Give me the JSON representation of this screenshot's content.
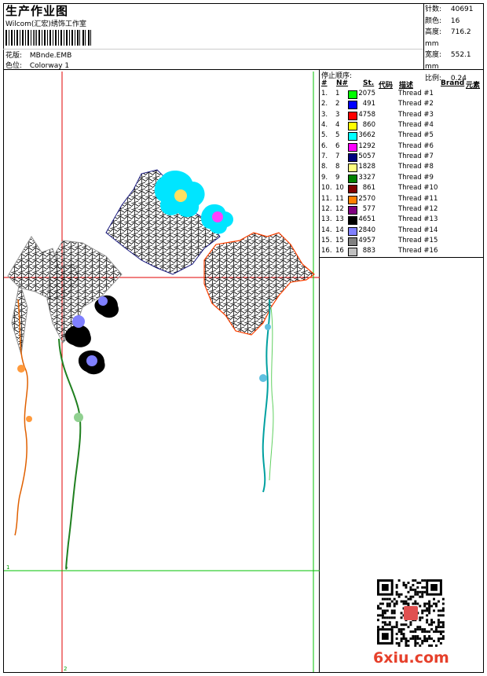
{
  "header": {
    "title": "生产作业图",
    "company": "Wilcom(汇宏)绣饰工作室",
    "design_label": "花版:",
    "design_value": "MBnde.EMB",
    "colorway_label": "色位:",
    "colorway_value": "Colorway 1"
  },
  "stats": [
    {
      "label": "针数:",
      "value": "40691"
    },
    {
      "label": "颜色:",
      "value": "16"
    },
    {
      "label": "高度:",
      "value": "716.2 mm"
    },
    {
      "label": "宽度:",
      "value": "552.1 mm"
    },
    {
      "label": "比例:",
      "value": "0.24"
    }
  ],
  "sequence": {
    "title": "停止顺序:",
    "columns": {
      "num": "#",
      "needle": "N#",
      "stitches": "St.",
      "code": "代码",
      "desc": "描述",
      "brand": "Brand",
      "element": "元素"
    },
    "rows": [
      {
        "num": "1.",
        "needle": "1",
        "color": "#00ff00",
        "stitches": "2075",
        "desc": "Thread #1"
      },
      {
        "num": "2.",
        "needle": "2",
        "color": "#0000ff",
        "stitches": "491",
        "desc": "Thread #2"
      },
      {
        "num": "3.",
        "needle": "3",
        "color": "#ff0000",
        "stitches": "4758",
        "desc": "Thread #3"
      },
      {
        "num": "4.",
        "needle": "4",
        "color": "#ffff00",
        "stitches": "860",
        "desc": "Thread #4"
      },
      {
        "num": "5.",
        "needle": "5",
        "color": "#00ffff",
        "stitches": "3662",
        "desc": "Thread #5"
      },
      {
        "num": "6.",
        "needle": "6",
        "color": "#ff00ff",
        "stitches": "1292",
        "desc": "Thread #6"
      },
      {
        "num": "7.",
        "needle": "7",
        "color": "#000080",
        "stitches": "5057",
        "desc": "Thread #7"
      },
      {
        "num": "8.",
        "needle": "8",
        "color": "#ffff80",
        "stitches": "1828",
        "desc": "Thread #8"
      },
      {
        "num": "9.",
        "needle": "9",
        "color": "#008000",
        "stitches": "3327",
        "desc": "Thread #9"
      },
      {
        "num": "10.",
        "needle": "10",
        "color": "#800000",
        "stitches": "861",
        "desc": "Thread #10"
      },
      {
        "num": "11.",
        "needle": "11",
        "color": "#ff8000",
        "stitches": "2570",
        "desc": "Thread #11"
      },
      {
        "num": "12.",
        "needle": "12",
        "color": "#800080",
        "stitches": "577",
        "desc": "Thread #12"
      },
      {
        "num": "13.",
        "needle": "13",
        "color": "#000000",
        "stitches": "4651",
        "desc": "Thread #13"
      },
      {
        "num": "14.",
        "needle": "14",
        "color": "#8080ff",
        "stitches": "2840",
        "desc": "Thread #14"
      },
      {
        "num": "15.",
        "needle": "15",
        "color": "#808080",
        "stitches": "4957",
        "desc": "Thread #15"
      },
      {
        "num": "16.",
        "needle": "16",
        "color": "#c0c0c0",
        "stitches": "883",
        "desc": "Thread #16"
      }
    ]
  },
  "canvas": {
    "guide_color_red": "#e00000",
    "guide_color_green": "#00c000",
    "guide_label_1": "1",
    "guide_label_2": "2"
  },
  "watermark": "6xiu.com"
}
